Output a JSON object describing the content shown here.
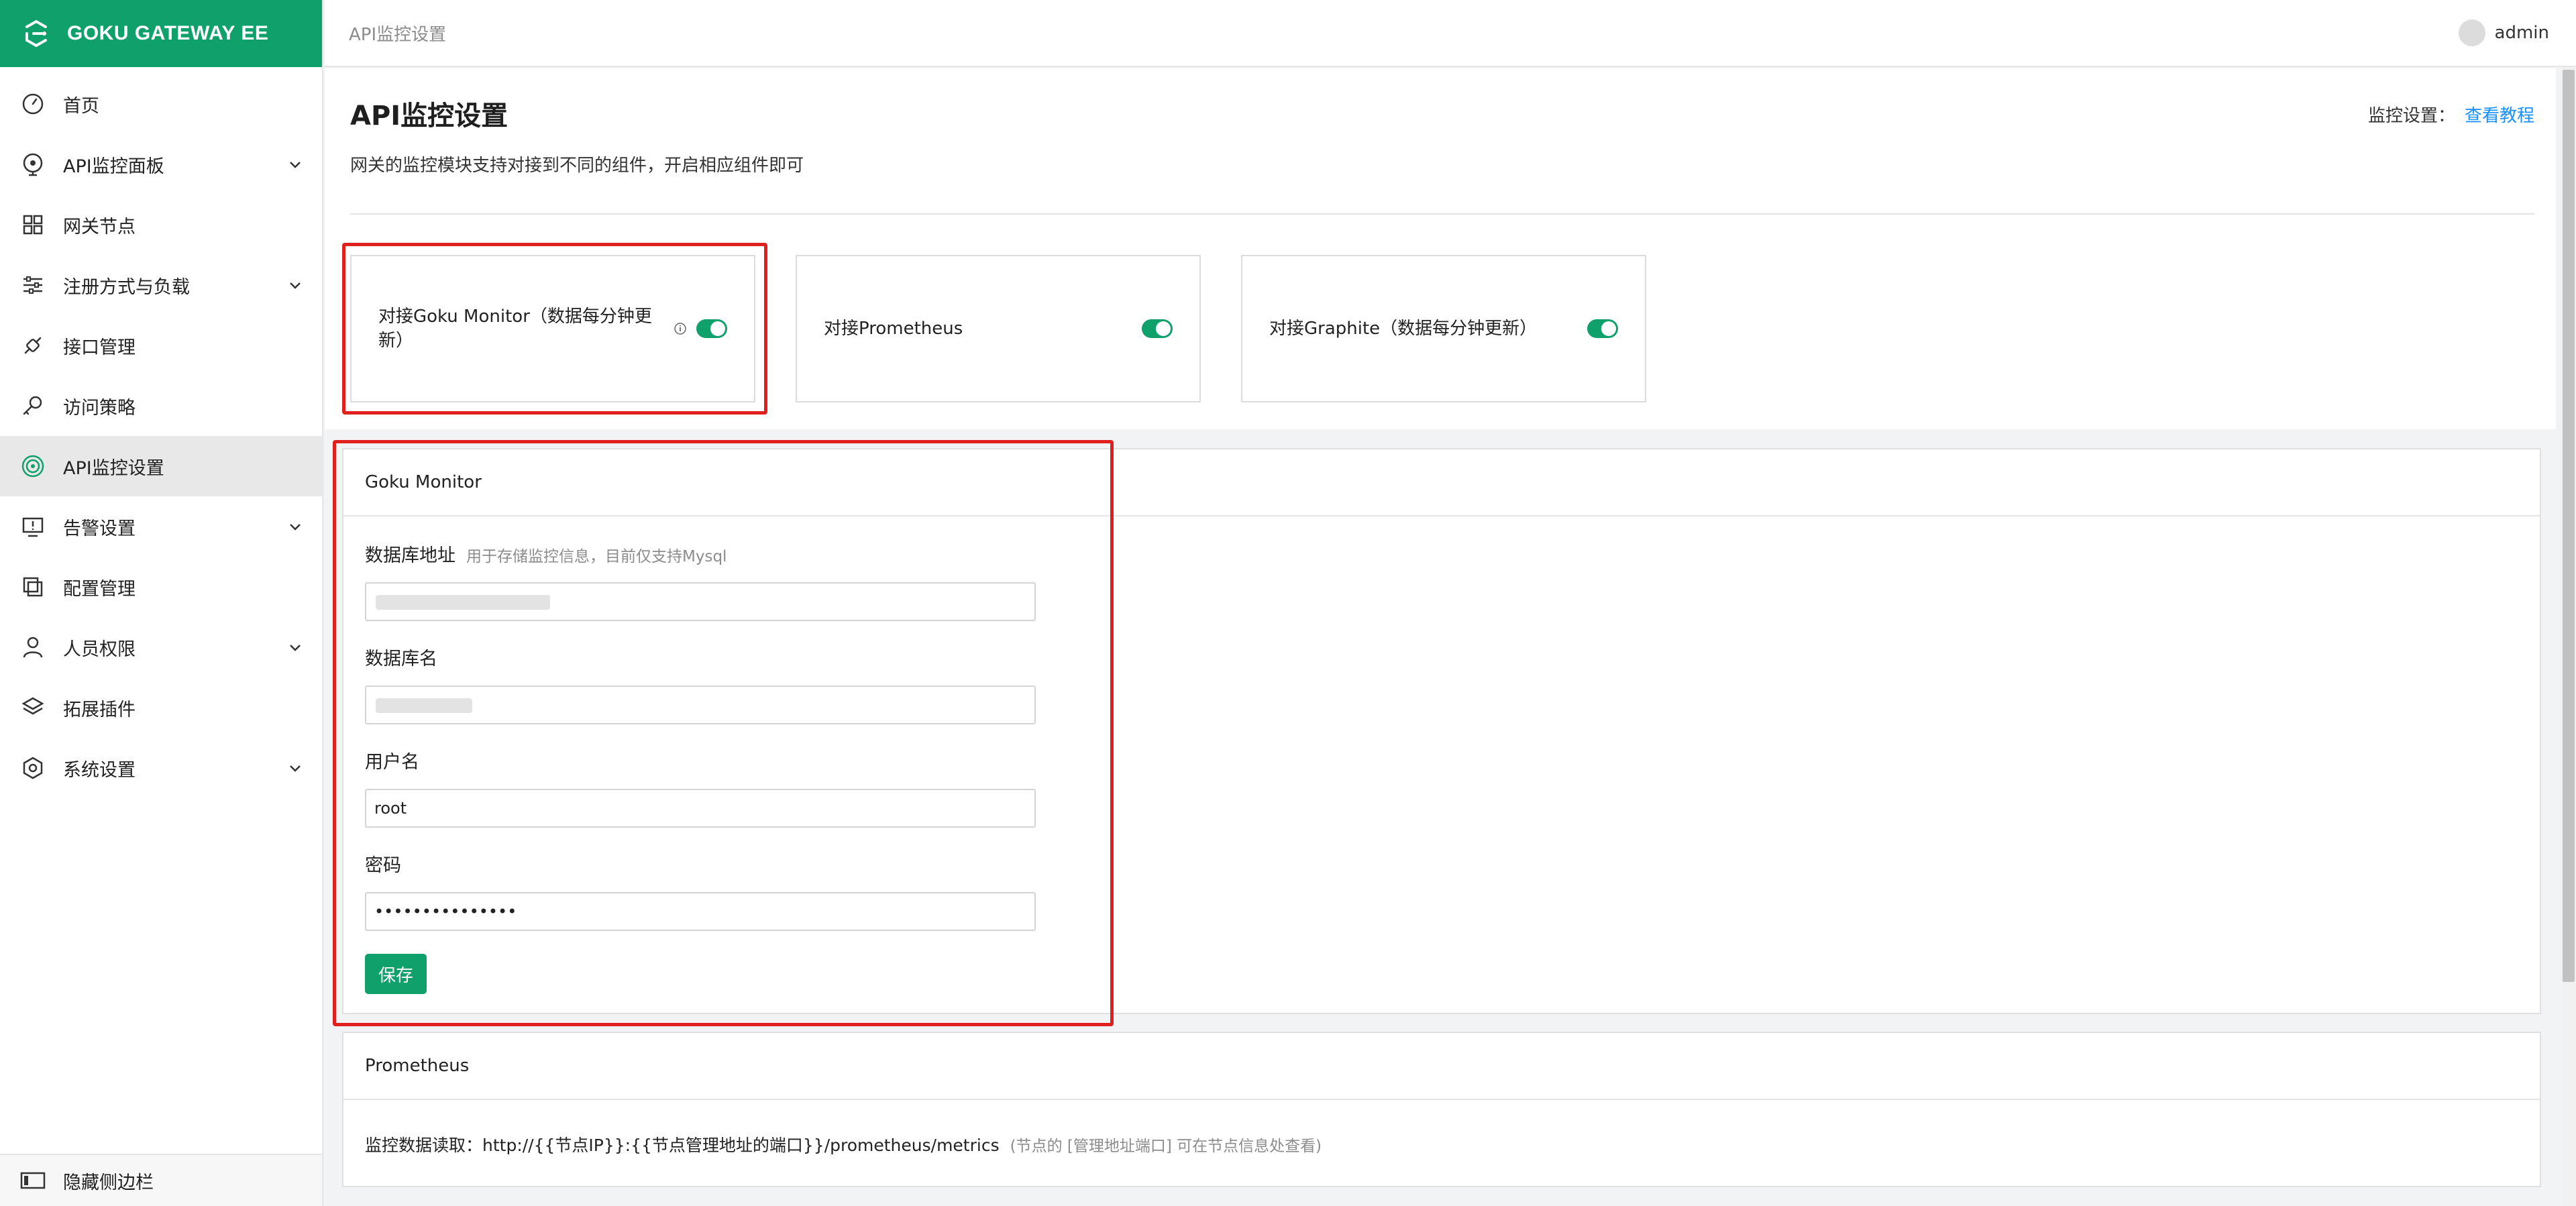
{
  "brand": {
    "name": "GOKU GATEWAY EE"
  },
  "sidebar": {
    "items": [
      {
        "label": "首页",
        "icon": "dashboard-icon",
        "expandable": false,
        "active": false
      },
      {
        "label": "API监控面板",
        "icon": "monitor-panel-icon",
        "expandable": true,
        "active": false
      },
      {
        "label": "网关节点",
        "icon": "grid-icon",
        "expandable": false,
        "active": false
      },
      {
        "label": "注册方式与负载",
        "icon": "sliders-icon",
        "expandable": true,
        "active": false
      },
      {
        "label": "接口管理",
        "icon": "api-link-icon",
        "expandable": false,
        "active": false
      },
      {
        "label": "访问策略",
        "icon": "key-icon",
        "expandable": false,
        "active": false
      },
      {
        "label": "API监控设置",
        "icon": "target-icon",
        "expandable": false,
        "active": true
      },
      {
        "label": "告警设置",
        "icon": "alert-monitor-icon",
        "expandable": true,
        "active": false
      },
      {
        "label": "配置管理",
        "icon": "layers-copy-icon",
        "expandable": false,
        "active": false
      },
      {
        "label": "人员权限",
        "icon": "user-icon",
        "expandable": true,
        "active": false
      },
      {
        "label": "拓展插件",
        "icon": "stack-icon",
        "expandable": false,
        "active": false
      },
      {
        "label": "系统设置",
        "icon": "gear-icon",
        "expandable": true,
        "active": false
      }
    ],
    "footer_label": "隐藏侧边栏"
  },
  "header": {
    "breadcrumb": "API监控设置",
    "user": "admin"
  },
  "page": {
    "title": "API监控设置",
    "description": "网关的监控模块支持对接到不同的组件，开启相应组件即可",
    "help_label": "监控设置：",
    "help_link": "查看教程"
  },
  "integrations": [
    {
      "label": "对接Goku Monitor（数据每分钟更新）",
      "enabled": true,
      "has_info": true
    },
    {
      "label": "对接Prometheus",
      "enabled": true,
      "has_info": false
    },
    {
      "label": "对接Graphite（数据每分钟更新）",
      "enabled": true,
      "has_info": false
    }
  ],
  "goku_monitor": {
    "title": "Goku Monitor",
    "db_address_label": "数据库地址",
    "db_address_hint": "用于存储监控信息，目前仅支持Mysql",
    "db_name_label": "数据库名",
    "username_label": "用户名",
    "username_value": "root",
    "password_label": "密码",
    "password_value": "•••••••••••••••",
    "save_label": "保存"
  },
  "prometheus": {
    "title": "Prometheus",
    "read_label": "监控数据读取：http://{{节点IP}}:{{节点管理地址的端口}}/prometheus/metrics",
    "read_hint": "(节点的 [管理地址端口] 可在节点信息处查看)"
  },
  "colors": {
    "brand": "#10a06c",
    "link": "#1890ff",
    "highlight": "#e0201c"
  }
}
